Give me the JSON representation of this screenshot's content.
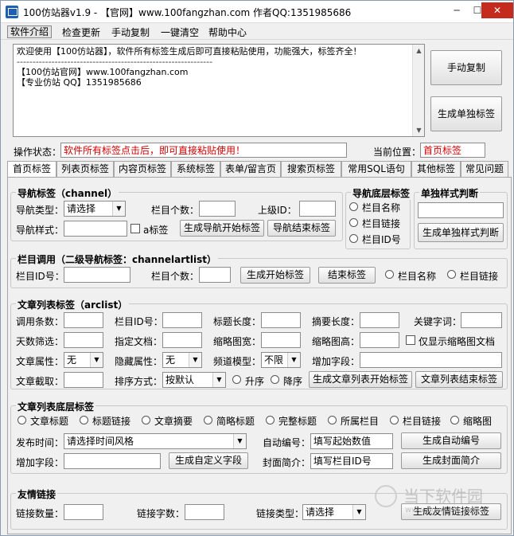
{
  "window": {
    "title": "100仿站器v1.9 - 【官网】www.100fangzhan.com  作者QQ:1351985686",
    "min": "─",
    "max": "☐",
    "close": "✕"
  },
  "menu": [
    "软件介绍",
    "检查更新",
    "手动复制",
    "一键清空",
    "帮助中心"
  ],
  "main": {
    "lines": [
      "欢迎使用【100仿站器】，软件所有标签生成后即可直接粘贴使用，功能强大，标签齐全！",
      "--------------------------------------------------------------",
      "【100仿站官网】www.100fangzhan.com",
      "【专业仿站 QQ】1351985686"
    ]
  },
  "right_buttons": {
    "copy": "手动复制",
    "single": "生成单独标签"
  },
  "status": {
    "label": "操作状态：",
    "text": "软件所有标签点击后，即可直接粘贴使用！",
    "pos_label": "当前位置：",
    "pos_value": "首页标签"
  },
  "tabs": [
    "首页标签",
    "列表页标签",
    "内容页标签",
    "系统标签",
    "表单/留言页",
    "搜索页标签",
    "常用SQL语句",
    "其他标签",
    "常见问题"
  ],
  "nav": {
    "title": "导航标签（channel）",
    "type_label": "导航类型：",
    "type_value": "请选择",
    "count_label": "栏目个数：",
    "parent_label": "上级ID：",
    "style_label": "导航样式：",
    "a_label": "a标签",
    "start_btn": "生成导航开始标签",
    "end_btn": "导航结束标签"
  },
  "navbottom": {
    "title": "导航底层标签",
    "opts": [
      "栏目名称",
      "栏目链接",
      "栏目ID号"
    ]
  },
  "single": {
    "title": "单独样式判断",
    "btn": "生成单独样式判断"
  },
  "col": {
    "title": "栏目调用（二级导航标签：channelartlist）",
    "id_label": "栏目ID号：",
    "count_label": "栏目个数：",
    "start_btn": "生成开始标签",
    "end_btn": "结束标签",
    "opt1": "栏目名称",
    "opt2": "栏目链接"
  },
  "arc": {
    "title": "文章列表标签（arclist）",
    "r1": [
      "调用条数：",
      "栏目ID号：",
      "标题长度：",
      "摘要长度：",
      "关键字词："
    ],
    "r2": [
      "天数筛选：",
      "指定文档：",
      "缩略图宽：",
      "缩略图高："
    ],
    "thumb_only": "仅显示缩略图文档",
    "attr_label": "文章属性：",
    "attr_value": "无",
    "hidden_label": "隐藏属性：",
    "hidden_value": "无",
    "model_label": "频道模型：",
    "model_value": "不限",
    "extra_label": "增加字段：",
    "cut_label": "文章截取：",
    "sort_label": "排序方式：",
    "sort_value": "按默认",
    "asc": "升序",
    "desc": "降序",
    "start_btn": "生成文章列表开始标签",
    "end_btn": "文章列表结束标签"
  },
  "arcbottom": {
    "title": "文章列表底层标签",
    "opts": [
      "文章标题",
      "标题链接",
      "文章摘要",
      "简略标题",
      "完整标题",
      "所属栏目",
      "栏目链接",
      "缩略图"
    ],
    "time_label": "发布时间：",
    "time_value": "请选择时间风格",
    "auto_label": "自动编号：",
    "auto_value": "填写起始数值",
    "auto_btn": "生成自动编号",
    "field_label": "增加字段：",
    "field_btn": "生成自定义字段",
    "cover_label": "封面简介：",
    "cover_value": "填写栏目ID号",
    "cover_btn": "生成封面简介"
  },
  "links": {
    "title": "友情链接",
    "count_label": "链接数量：",
    "chars_label": "链接字数：",
    "type_label": "链接类型：",
    "type_value": "请选择",
    "btn": "生成友情链接标签"
  },
  "watermark": {
    "text": "当下软件园",
    "sub": "www.downxia.com"
  },
  "colors": {
    "accent": "#1e5fb4",
    "status_text": "#d40000",
    "close_bg": "#c42b1c"
  },
  "icons": {
    "arrow": "▼",
    "up": "▲"
  }
}
